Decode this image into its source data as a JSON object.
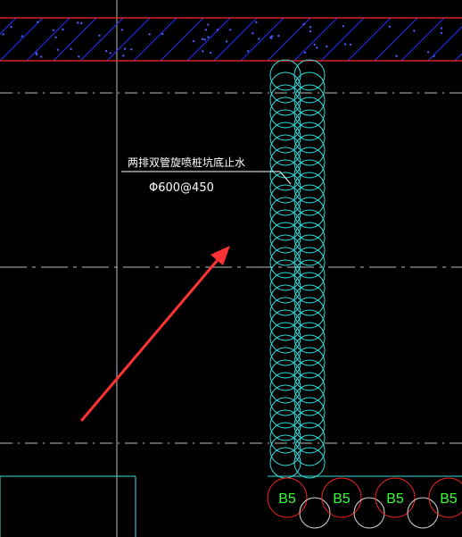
{
  "annotation": {
    "title": "两排双管旋喷桩坑底止水",
    "spec": "Φ600@450"
  },
  "pile_labels": [
    "B5",
    "B5",
    "B5",
    "B5"
  ],
  "colors": {
    "background": "#000000",
    "hatch_border": "#ff2a2a",
    "hatch_lines": "#2233ff",
    "piles": "#33dddd",
    "leader": "#ffffff",
    "arrow": "#ff3333",
    "centerline": "#cccccc",
    "label_circles": "#ee2222",
    "label_text": "#33ff33"
  }
}
